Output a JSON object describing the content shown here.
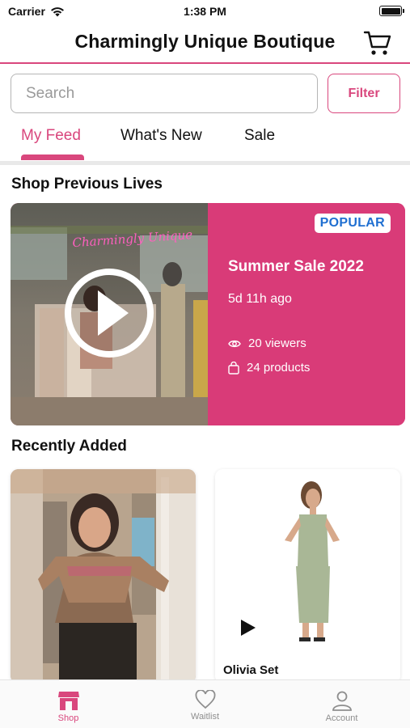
{
  "status_bar": {
    "carrier": "Carrier",
    "time": "1:38 PM"
  },
  "header": {
    "title": "Charmingly Unique Boutique"
  },
  "search": {
    "placeholder": "Search",
    "filter_label": "Filter"
  },
  "tabs": [
    {
      "label": "My Feed",
      "active": true
    },
    {
      "label": "What's New",
      "active": false
    },
    {
      "label": "Sale",
      "active": false
    }
  ],
  "sections": {
    "previous_lives": "Shop Previous Lives",
    "recently_added": "Recently Added"
  },
  "live_card": {
    "badge": "POPULAR",
    "title": "Summer Sale 2022",
    "time_ago": "5d 11h ago",
    "viewers": "20 viewers",
    "products": "24 products",
    "neon_sign": "Charmingly Unique"
  },
  "products": [
    {
      "name": ""
    },
    {
      "name": "Olivia Set"
    }
  ],
  "tabbar": [
    {
      "label": "Shop",
      "icon": "shop-icon",
      "active": true
    },
    {
      "label": "Waitlist",
      "icon": "heart-icon",
      "active": false
    },
    {
      "label": "Account",
      "icon": "account-icon",
      "active": false
    }
  ],
  "colors": {
    "accent": "#d9477d",
    "card": "#d93b78",
    "badge_text": "#1f6fd1"
  }
}
